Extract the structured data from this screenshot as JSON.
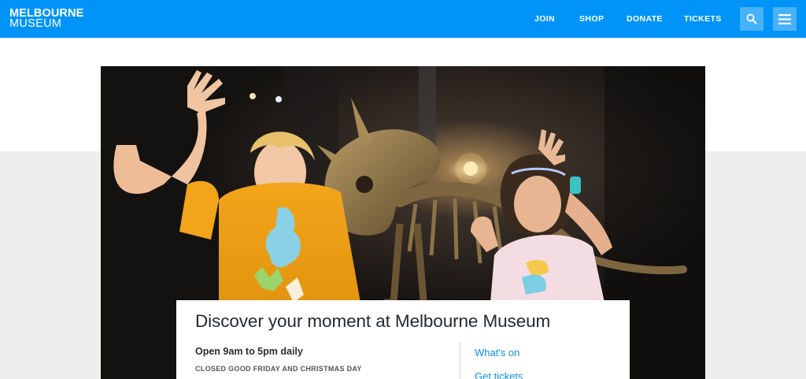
{
  "brand": {
    "line1": "MELBOURNE",
    "line2": "MUSEUM"
  },
  "nav": {
    "join": "JOIN",
    "shop": "SHOP",
    "donate": "DONATE",
    "tickets": "TICKETS"
  },
  "icons": {
    "search": "search-icon",
    "menu": "hamburger-menu-icon"
  },
  "colors": {
    "header": "#0094f9",
    "link": "#0b8fe6",
    "band": "#eeeeee"
  },
  "card": {
    "title": "Discover your moment at Melbourne Museum",
    "hours": "Open 9am to 5pm daily",
    "closed": "CLOSED GOOD FRIDAY AND CHRISTMAS DAY",
    "links": [
      "What's on",
      "Get tickets"
    ]
  }
}
